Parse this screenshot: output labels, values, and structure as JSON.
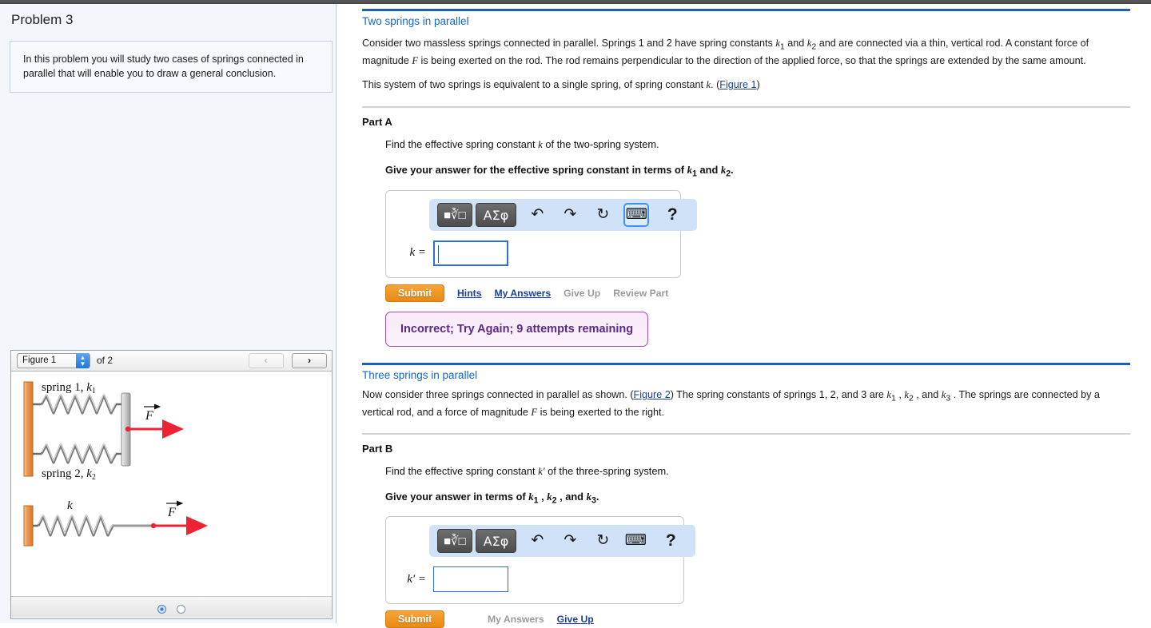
{
  "left": {
    "problem_title": "Problem 3",
    "intro_text": "In this problem you will study two cases of springs connected in parallel that will enable you to draw a general conclusion.",
    "figure_nav": {
      "selected_figure": "Figure 1",
      "of_label": "of 2",
      "prev_label": "‹",
      "next_label": "›"
    },
    "figure1": {
      "spring1_label": "spring 1, k₁",
      "spring2_label": "spring 2, k₂",
      "force_label": "F",
      "equiv_spring_label": "k",
      "equiv_force_label": "F"
    },
    "pager": {
      "total": 2,
      "active": 1
    }
  },
  "right": {
    "section1": {
      "title": "Two springs in parallel",
      "para1_a": "Consider two massless springs connected in parallel. Springs 1 and 2 have spring constants ",
      "para1_k1": "k",
      "para1_k1sub": "1",
      "para1_b": " and ",
      "para1_k2": "k",
      "para1_k2sub": "2",
      "para1_c": " and are connected via a thin, vertical rod. A constant force of magnitude ",
      "para1_F": "F",
      "para1_d": " is being exerted on the rod. The rod remains perpendicular to the direction of the applied force, so that the springs are extended by the same amount.",
      "para2_a": "This system of two springs is equivalent to a single spring, of spring constant ",
      "para2_k": "k",
      "para2_b": ". (",
      "para2_link": "Figure 1",
      "para2_c": ")"
    },
    "partA": {
      "heading": "Part A",
      "question_a": "Find the effective spring constant ",
      "question_k": "k",
      "question_b": " of the two-spring system.",
      "instruction_a": "Give your answer for the effective spring constant in terms of ",
      "instruction_k1": "k",
      "instruction_k1sub": "1",
      "instruction_mid": " and ",
      "instruction_k2": "k",
      "instruction_k2sub": "2",
      "instruction_end": ".",
      "toolbar": {
        "template_icon": "template-sqrt-icon",
        "greek_label": "ΑΣφ",
        "undo_icon": "undo-icon",
        "redo_icon": "redo-icon",
        "reset_icon": "reset-icon",
        "keyboard_icon": "keyboard-icon",
        "help_label": "?"
      },
      "answer_label": "k =",
      "answer_value": "",
      "submit_label": "Submit",
      "links": [
        {
          "label": "Hints",
          "state": "active"
        },
        {
          "label": "My Answers",
          "state": "active"
        },
        {
          "label": "Give Up",
          "state": "disabled"
        },
        {
          "label": "Review Part",
          "state": "disabled"
        }
      ],
      "feedback": "Incorrect; Try Again; 9 attempts remaining"
    },
    "section2": {
      "title": "Three springs in parallel",
      "para_a": "Now consider three springs connected in parallel as shown. (",
      "para_link": "Figure 2",
      "para_b": ") The spring constants of springs 1, 2, and 3 are ",
      "para_k1": "k",
      "para_k1sub": "1",
      "para_c": " , ",
      "para_k2": "k",
      "para_k2sub": "2",
      "para_d": " , and ",
      "para_k3": "k",
      "para_k3sub": "3",
      "para_e": " . The springs are connected by a vertical rod, and a force of magnitude ",
      "para_F": "F",
      "para_f": " is being exerted to the right."
    },
    "partB": {
      "heading": "Part B",
      "question_a": "Find the effective spring constant ",
      "question_k": "k′",
      "question_b": " of the three-spring system.",
      "instruction_a": "Give your answer in terms of ",
      "instruction_k1": "k",
      "instruction_k1sub": "1",
      "instruction_mid1": " , ",
      "instruction_k2": "k",
      "instruction_k2sub": "2",
      "instruction_mid2": " , and ",
      "instruction_k3": "k",
      "instruction_k3sub": "3",
      "instruction_end": ".",
      "toolbar": {
        "greek_label": "ΑΣφ",
        "help_label": "?"
      },
      "answer_label": "k′ =",
      "answer_value": "",
      "submit_label": "Submit",
      "links": [
        {
          "label": "My Answers",
          "state": "disabled"
        },
        {
          "label": "Give Up",
          "state": "active"
        }
      ]
    }
  },
  "colors": {
    "accent_blue": "#1567c4",
    "rule_blue": "#1963b3",
    "submit_orange": "#e88a15",
    "feedback_purple": "#5b2c83",
    "feedback_bg": "#f8e9f8",
    "toolbar_blue": "#cfe2f7",
    "left_panel_bg": "#f3f7fc",
    "wall_orange": "#e08a3c"
  }
}
